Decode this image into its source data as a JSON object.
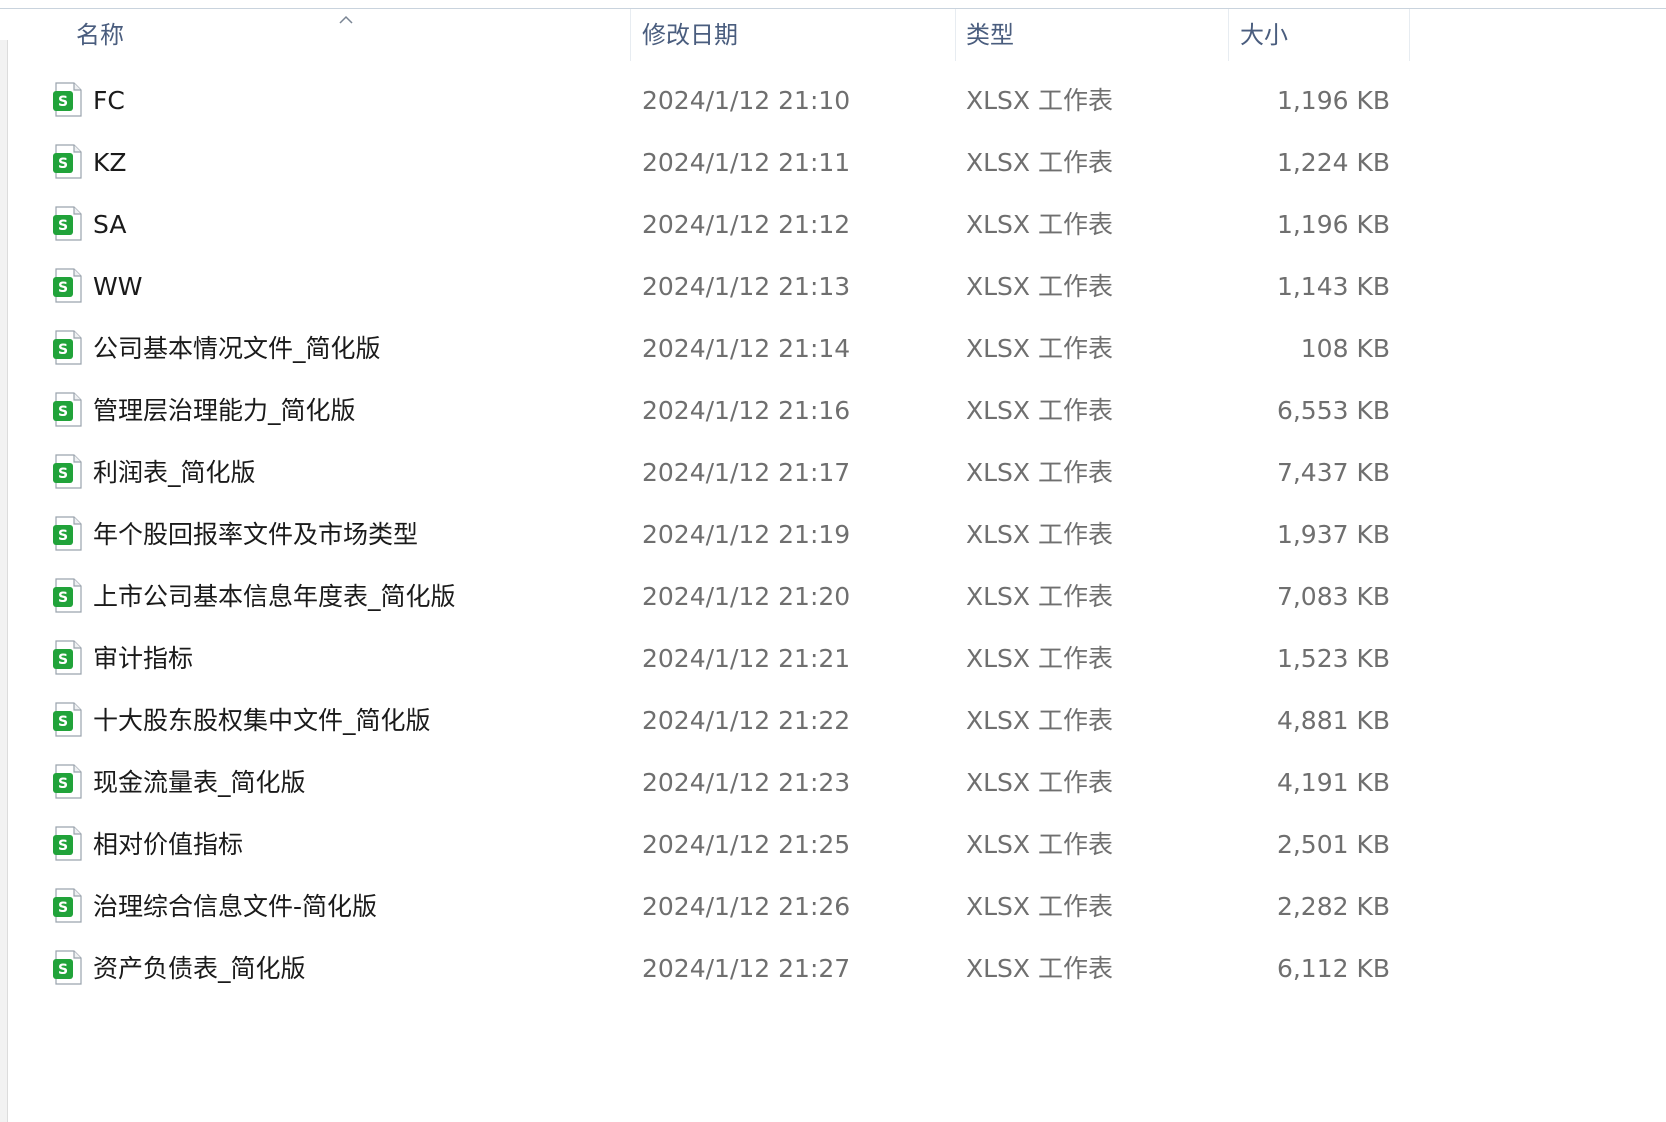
{
  "columns": {
    "name": "名称",
    "date": "修改日期",
    "type": "类型",
    "size": "大小"
  },
  "sort": {
    "column": "name",
    "direction": "ascending"
  },
  "icon": "xlsx-spreadsheet-icon",
  "accent_color": "#21a33a",
  "files": [
    {
      "name": "FC",
      "date": "2024/1/12 21:10",
      "type": "XLSX 工作表",
      "size": "1,196 KB"
    },
    {
      "name": "KZ",
      "date": "2024/1/12 21:11",
      "type": "XLSX 工作表",
      "size": "1,224 KB"
    },
    {
      "name": "SA",
      "date": "2024/1/12 21:12",
      "type": "XLSX 工作表",
      "size": "1,196 KB"
    },
    {
      "name": "WW",
      "date": "2024/1/12 21:13",
      "type": "XLSX 工作表",
      "size": "1,143 KB"
    },
    {
      "name": "公司基本情况文件_简化版",
      "date": "2024/1/12 21:14",
      "type": "XLSX 工作表",
      "size": "108 KB"
    },
    {
      "name": "管理层治理能力_简化版",
      "date": "2024/1/12 21:16",
      "type": "XLSX 工作表",
      "size": "6,553 KB"
    },
    {
      "name": "利润表_简化版",
      "date": "2024/1/12 21:17",
      "type": "XLSX 工作表",
      "size": "7,437 KB"
    },
    {
      "name": "年个股回报率文件及市场类型",
      "date": "2024/1/12 21:19",
      "type": "XLSX 工作表",
      "size": "1,937 KB"
    },
    {
      "name": "上市公司基本信息年度表_简化版",
      "date": "2024/1/12 21:20",
      "type": "XLSX 工作表",
      "size": "7,083 KB"
    },
    {
      "name": "审计指标",
      "date": "2024/1/12 21:21",
      "type": "XLSX 工作表",
      "size": "1,523 KB"
    },
    {
      "name": "十大股东股权集中文件_简化版",
      "date": "2024/1/12 21:22",
      "type": "XLSX 工作表",
      "size": "4,881 KB"
    },
    {
      "name": "现金流量表_简化版",
      "date": "2024/1/12 21:23",
      "type": "XLSX 工作表",
      "size": "4,191 KB"
    },
    {
      "name": "相对价值指标",
      "date": "2024/1/12 21:25",
      "type": "XLSX 工作表",
      "size": "2,501 KB"
    },
    {
      "name": "治理综合信息文件-简化版",
      "date": "2024/1/12 21:26",
      "type": "XLSX 工作表",
      "size": "2,282 KB"
    },
    {
      "name": "资产负债表_简化版",
      "date": "2024/1/12 21:27",
      "type": "XLSX 工作表",
      "size": "6,112 KB"
    }
  ]
}
